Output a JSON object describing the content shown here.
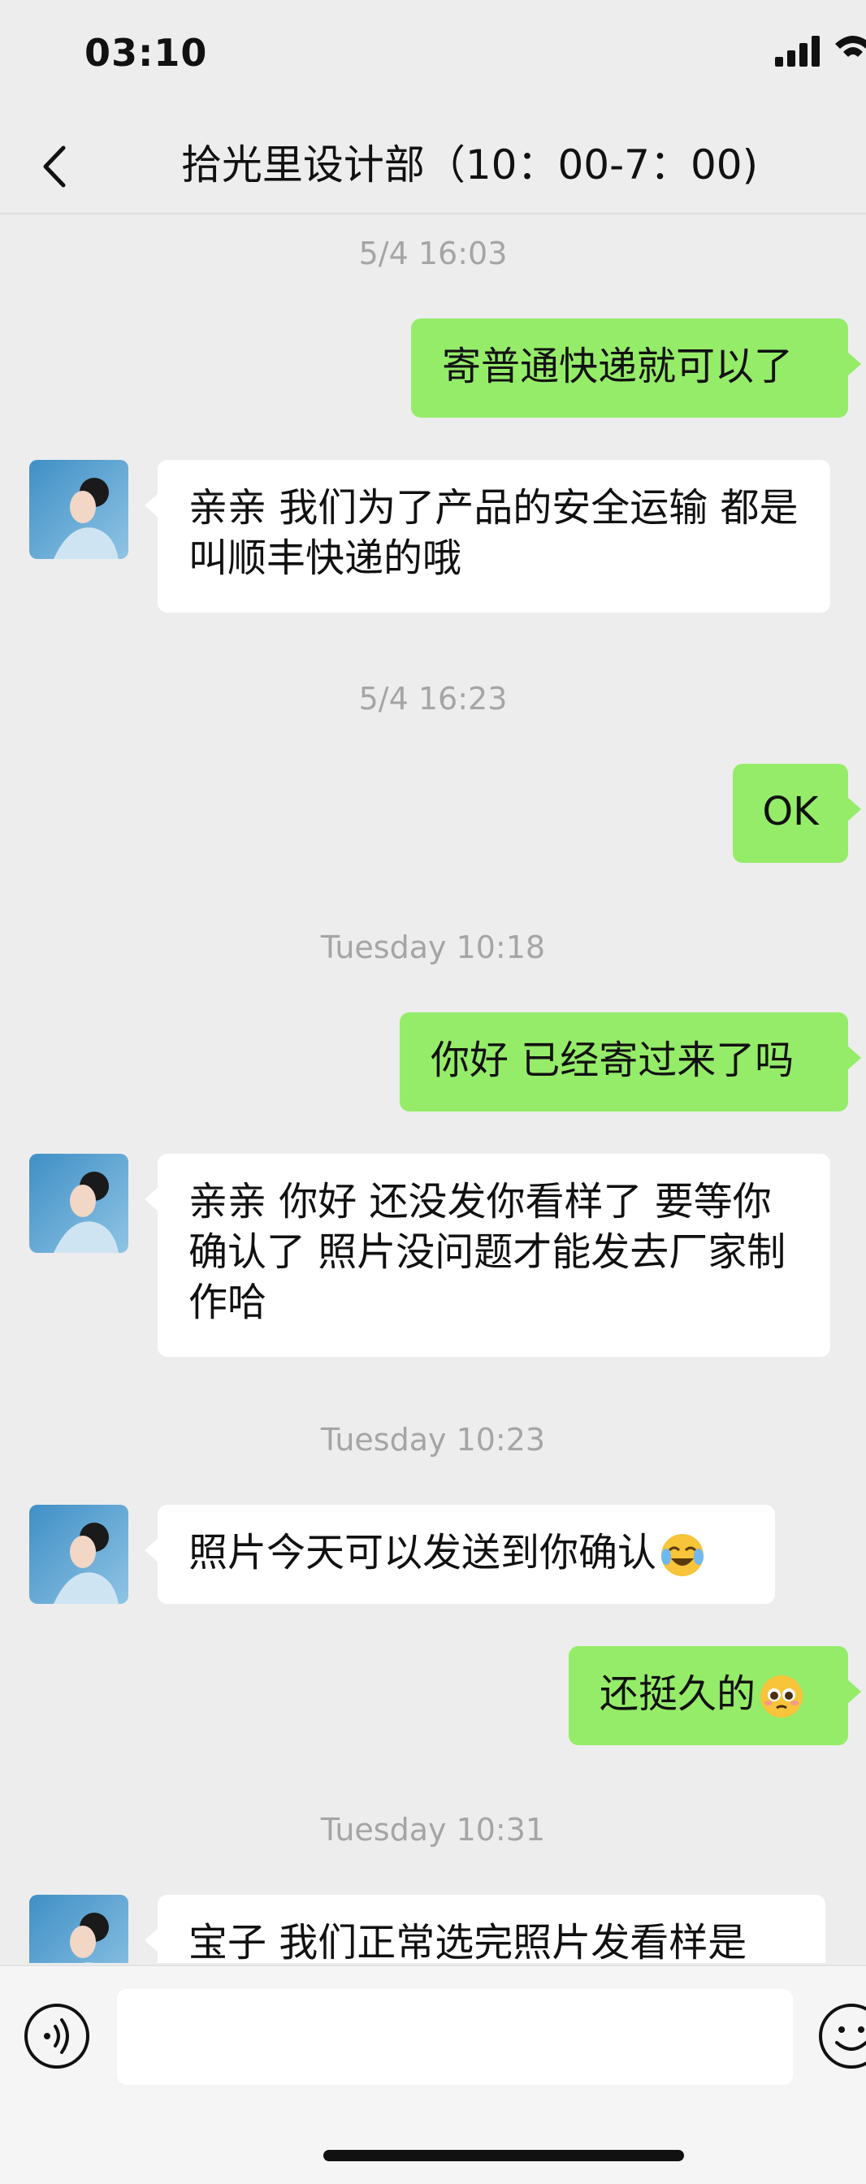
{
  "status_bar": {
    "time": "03:10"
  },
  "header": {
    "title": "拾光里设计部（10：00-7：00)"
  },
  "messages": [
    {
      "kind": "timestamp",
      "text": "5/4 16:03"
    },
    {
      "kind": "out",
      "text": "寄普通快递就可以了"
    },
    {
      "kind": "in",
      "text": "亲亲 我们为了产品的安全运输 都是叫顺丰快递的哦"
    },
    {
      "kind": "timestamp",
      "text": "5/4 16:23"
    },
    {
      "kind": "out",
      "text": "OK"
    },
    {
      "kind": "timestamp",
      "text": "Tuesday 10:18"
    },
    {
      "kind": "out",
      "text": "你好 已经寄过来了吗"
    },
    {
      "kind": "in",
      "text": "亲亲  你好  还没发你看样了  要等你确认了 照片没问题才能发去厂家制作哈"
    },
    {
      "kind": "timestamp",
      "text": "Tuesday 10:23"
    },
    {
      "kind": "in",
      "text": "照片今天可以发送到你确认",
      "emoji": "crying-laughing-emoji"
    },
    {
      "kind": "out",
      "text": "还挺久的",
      "emoji": "pleading-face-emoji"
    },
    {
      "kind": "timestamp",
      "text": "Tuesday 10:31"
    },
    {
      "kind": "in",
      "text": "宝子 我们正常选完照片发看样是"
    }
  ],
  "input_bar": {
    "voice_icon": "voice-icon",
    "emoji_icon": "emoji-icon",
    "text_value": ""
  },
  "colors": {
    "background": "#ededed",
    "outgoing_bubble": "#95ec69",
    "incoming_bubble": "#ffffff",
    "timestamp": "#a5a5a5"
  }
}
